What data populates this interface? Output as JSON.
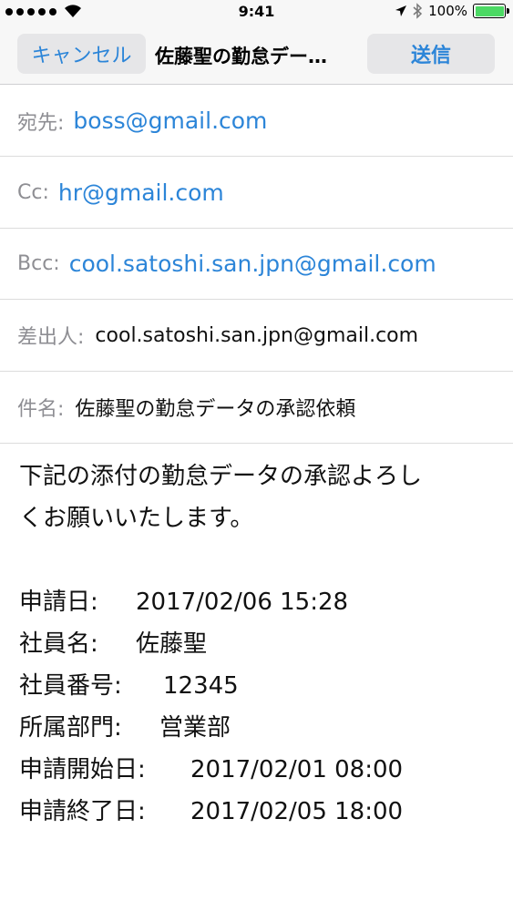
{
  "status_bar": {
    "time": "9:41",
    "battery": "100%",
    "battery_fill": 1.0,
    "icons": [
      "signal-dots-icon",
      "wifi-icon",
      "location-arrow-icon",
      "bluetooth-icon",
      "battery-icon"
    ]
  },
  "nav": {
    "cancel_label": "キャンセル",
    "title": "佐藤聖の勤怠デー…",
    "send_label": "送信"
  },
  "fields": {
    "to": {
      "label": "宛先:",
      "value": "boss@gmail.com"
    },
    "cc": {
      "label": "Cc:",
      "value": "hr@gmail.com"
    },
    "bcc": {
      "label": "Bcc:",
      "value": "cool.satoshi.san.jpn@gmail.com"
    },
    "from": {
      "label": "差出人:",
      "value": "cool.satoshi.san.jpn@gmail.com"
    },
    "subject": {
      "label": "件名:",
      "value": "佐藤聖の勤怠データの承認依頼"
    }
  },
  "body": {
    "line1": "下記の添付の勤怠データの承認よろし",
    "line2": "くお願いいたします。",
    "details": [
      {
        "key": "申請日:",
        "value": "2017/02/06 15:28"
      },
      {
        "key": "社員名:",
        "value": "佐藤聖"
      },
      {
        "key": "社員番号:",
        "value": "12345"
      },
      {
        "key": "所属部門:",
        "value": "営業部"
      },
      {
        "key": "申請開始日:",
        "value": "2017/02/01 08:00"
      },
      {
        "key": "申請終了日:",
        "value": "2017/02/05 18:00"
      }
    ]
  },
  "colors": {
    "accent": "#2c85d8",
    "label_gray": "#8e8e93",
    "battery_green": "#4cd964"
  }
}
